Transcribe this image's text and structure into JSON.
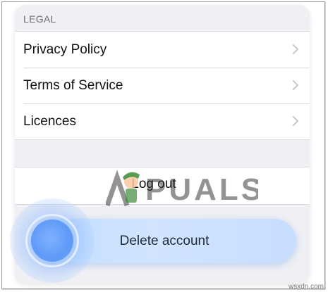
{
  "legal": {
    "header": "LEGAL",
    "items": [
      {
        "label": "Privacy Policy"
      },
      {
        "label": "Terms of Service"
      },
      {
        "label": "Licences"
      }
    ]
  },
  "logout_label": "Log out",
  "delete_label": "Delete account",
  "watermark_text": "APPUALS",
  "credit_text": "wsxdn.com",
  "colors": {
    "background": "#efeff4",
    "row": "#ffffff",
    "separator": "#d9d9de",
    "chevron": "#c7c7cc",
    "delete_button": "#c8ddff",
    "touch": "#5f9af7"
  }
}
